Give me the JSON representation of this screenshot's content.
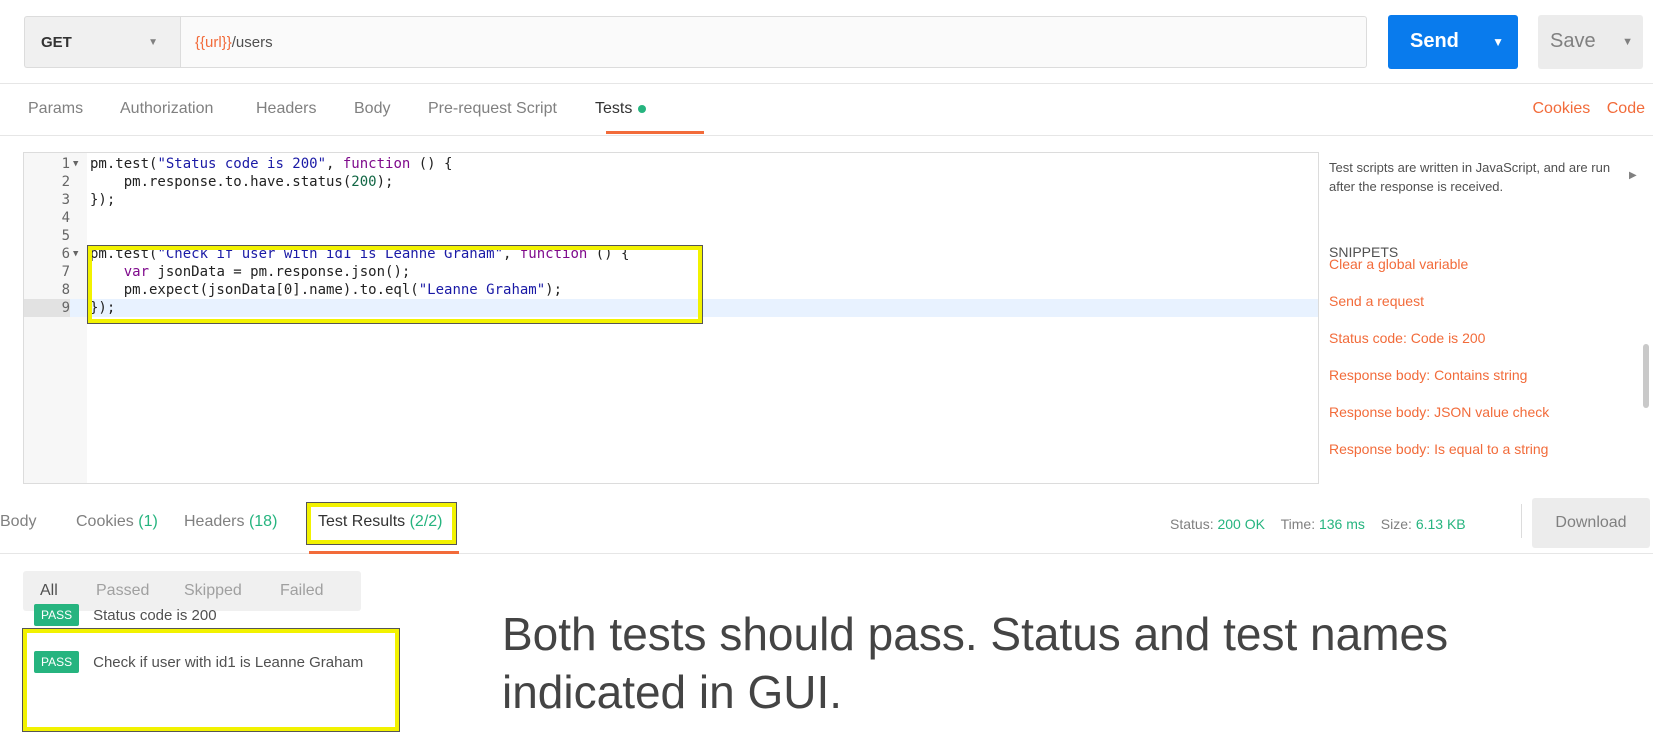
{
  "request": {
    "method": "GET",
    "url_var": "{{url}}",
    "url_path": "/users",
    "send_label": "Send",
    "save_label": "Save"
  },
  "request_tabs": {
    "params": "Params",
    "authorization": "Authorization",
    "headers": "Headers",
    "body": "Body",
    "prerequest": "Pre-request Script",
    "tests": "Tests",
    "cookies_link": "Cookies",
    "code_link": "Code"
  },
  "editor": {
    "lines": [
      {
        "num": "1",
        "text": "pm.test(\"Status code is 200\", function () {"
      },
      {
        "num": "2",
        "text": "    pm.response.to.have.status(200);"
      },
      {
        "num": "3",
        "text": "});"
      },
      {
        "num": "4",
        "text": ""
      },
      {
        "num": "5",
        "text": ""
      },
      {
        "num": "6",
        "text": "pm.test(\"Check if user with id1 is Leanne Graham\", function () {"
      },
      {
        "num": "7",
        "text": "    var jsonData = pm.response.json();"
      },
      {
        "num": "8",
        "text": "    pm.expect(jsonData[0].name).to.eql(\"Leanne Graham\");"
      },
      {
        "num": "9",
        "text": "});"
      }
    ]
  },
  "snippets": {
    "description": "Test scripts are written in JavaScript, and are run after the response is received.",
    "heading": "SNIPPETS",
    "items": [
      "Clear a global variable",
      "Send a request",
      "Status code: Code is 200",
      "Response body: Contains string",
      "Response body: JSON value check",
      "Response body: Is equal to a string"
    ]
  },
  "response_tabs": {
    "body": "Body",
    "cookies": "Cookies",
    "cookies_count": "(1)",
    "headers": "Headers",
    "headers_count": "(18)",
    "test_results": "Test Results",
    "test_results_count": "(2/2)"
  },
  "status_bar": {
    "status_label": "Status:",
    "status_value": "200 OK",
    "time_label": "Time:",
    "time_value": "136 ms",
    "size_label": "Size:",
    "size_value": "6.13 KB",
    "download_label": "Download"
  },
  "filters": [
    "All",
    "Passed",
    "Skipped",
    "Failed"
  ],
  "results": [
    {
      "badge": "PASS",
      "name": "Status code is 200"
    },
    {
      "badge": "PASS",
      "name": "Check if user with id1 is Leanne Graham"
    }
  ],
  "caption": {
    "line1": "Both tests should pass. Status and test names",
    "line2": "indicated in GUI."
  },
  "colors": {
    "accent_orange": "#f26b3a",
    "send_blue": "#097bed",
    "pass_green": "#26b47f",
    "highlight_yellow": "#f2f200"
  }
}
